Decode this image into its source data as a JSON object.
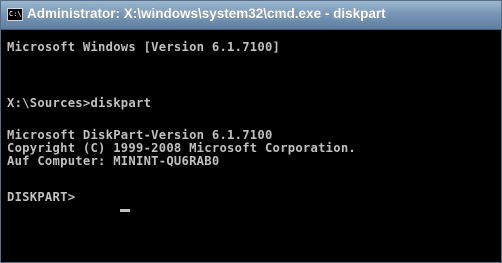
{
  "window": {
    "title": "Administrator: X:\\windows\\system32\\cmd.exe - diskpart",
    "icon": "cmd-icon",
    "icon_glyph": "C:\\"
  },
  "console": {
    "lines": [
      "Microsoft Windows [Version 6.1.7100]",
      "X:\\Sources>diskpart",
      "Microsoft DiskPart-Version 6.1.7100",
      "Copyright (C) 1999-2008 Microsoft Corporation.",
      "Auf Computer: MININT-QU6RAB0",
      "DISKPART> "
    ],
    "text_color": "#c0c0c0",
    "background_color": "#000000"
  }
}
